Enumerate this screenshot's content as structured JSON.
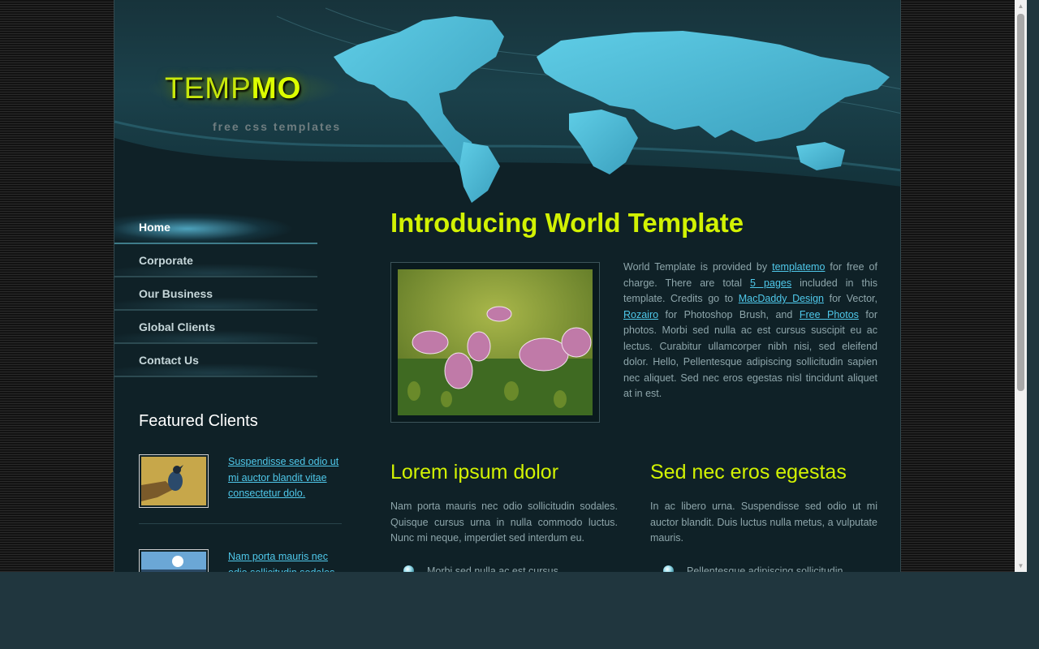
{
  "logo": {
    "part1": "TEMP",
    "part2": "MO",
    "tagline": "free css templates"
  },
  "menu": [
    {
      "label": "Home",
      "active": true
    },
    {
      "label": "Corporate",
      "active": false
    },
    {
      "label": "Our Business",
      "active": false
    },
    {
      "label": "Global Clients",
      "active": false
    },
    {
      "label": "Contact Us",
      "active": false
    }
  ],
  "featured": {
    "title": "Featured Clients",
    "clients": [
      {
        "text": "Suspendisse sed odio ut mi auctor blandit vitae consectetur dolo."
      },
      {
        "text": "Nam porta mauris nec odio sollicitudin sodales."
      }
    ]
  },
  "main": {
    "title": "Introducing World Template",
    "intro": {
      "t1": "World Template is provided by ",
      "link1": "templatemo",
      "t2": " for free of charge. There are total ",
      "link2": "5 pages",
      "t3": " included in this template. Credits go to ",
      "link3": "MacDaddy Design",
      "t4": " for Vector, ",
      "link4": "Rozairo",
      "t5": " for Photoshop Brush, and ",
      "link5": "Free Photos",
      "t6": " for photos. Morbi sed nulla ac est cursus suscipit eu ac lectus. Curabitur ullamcorper nibh nisi, sed eleifend dolor. Hello, Pellentesque adipiscing sollicitudin sapien nec aliquet. Sed nec eros egestas nisl tincidunt aliquet at in est."
    },
    "col1": {
      "title": "Lorem ipsum dolor",
      "text": "Nam porta mauris nec odio sollicitudin sodales. Quisque cursus urna in nulla commodo luctus. Nunc mi neque, imperdiet sed interdum eu.",
      "bullet": "Morbi sed nulla ac est cursus"
    },
    "col2": {
      "title": "Sed nec eros egestas",
      "text": "In ac libero urna. Suspendisse sed odio ut mi auctor blandit. Duis luctus nulla metus, a vulputate mauris.",
      "bullet": "Pellentesque adipiscing sollicitudin"
    }
  },
  "colors": {
    "accent": "#d2f203",
    "link": "#4fc8ea",
    "body_text": "#8ea6ab",
    "page_bg": "#0f2127"
  },
  "icons": {
    "scroll_up": "triangle-up",
    "scroll_down": "triangle-down",
    "bullet": "globe-bullet"
  }
}
